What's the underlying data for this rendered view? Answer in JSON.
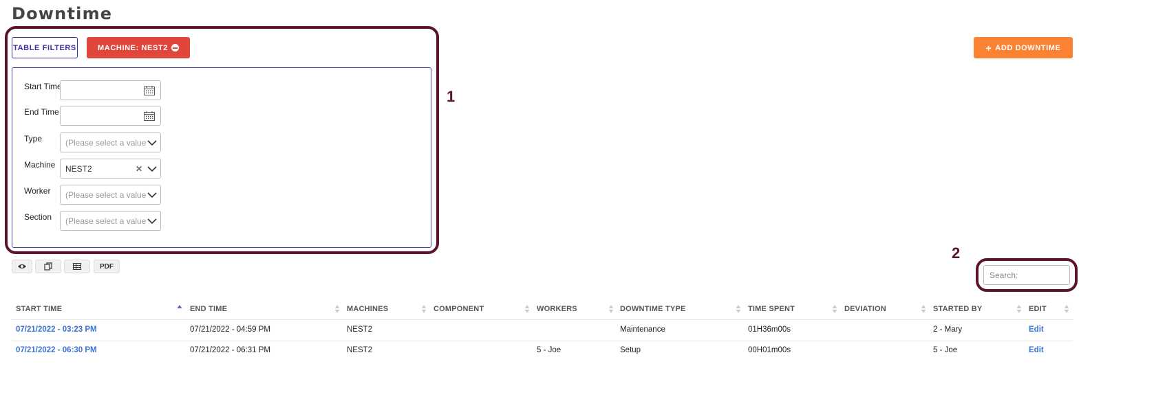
{
  "page": {
    "title": "Downtime"
  },
  "callouts": {
    "first": "1",
    "second": "2"
  },
  "toolbar": {
    "table_filters": "TABLE FILTERS",
    "machine_chip": "MACHINE: NEST2",
    "add_downtime": "ADD DOWNTIME"
  },
  "filters": {
    "start_time": {
      "label": "Start Time",
      "value": ""
    },
    "end_time": {
      "label": "End Time",
      "value": ""
    },
    "type": {
      "label": "Type",
      "placeholder": "(Please select a value)"
    },
    "machine": {
      "label": "Machine",
      "value": "NEST2"
    },
    "worker": {
      "label": "Worker",
      "placeholder": "(Please select a value)"
    },
    "section": {
      "label": "Section",
      "placeholder": "(Please select a value)"
    }
  },
  "table_tools": {
    "pdf": "PDF"
  },
  "search": {
    "placeholder": "Search:"
  },
  "table": {
    "columns": [
      "START TIME",
      "END TIME",
      "MACHINES",
      "COMPONENT",
      "WORKERS",
      "DOWNTIME TYPE",
      "TIME SPENT",
      "DEVIATION",
      "STARTED BY",
      "EDIT"
    ],
    "rows": [
      {
        "start_time": "07/21/2022 - 03:23 PM",
        "end_time": "07/21/2022 - 04:59 PM",
        "machines": "NEST2",
        "component": "",
        "workers": "",
        "downtime_type": "Maintenance",
        "time_spent": "01H36m00s",
        "deviation": "",
        "started_by": "2 - Mary",
        "edit": "Edit"
      },
      {
        "start_time": "07/21/2022 - 06:30 PM",
        "end_time": "07/21/2022 - 06:31 PM",
        "machines": "NEST2",
        "component": "",
        "workers": "5 - Joe",
        "downtime_type": "Setup",
        "time_spent": "00H01m00s",
        "deviation": "",
        "started_by": "5 - Joe",
        "edit": "Edit"
      }
    ]
  },
  "colors": {
    "accent_purple": "#3a30a0",
    "chip_red": "#e0463a",
    "add_orange": "#fb8232",
    "link_blue": "#3b73d4",
    "callout": "#5a1330"
  },
  "icons": {
    "chip": "minus-circle-icon",
    "add": "plus-icon",
    "date": "calendar-icon",
    "select": "chevron-down-icon",
    "clear": "clear-x-icon",
    "tools": [
      "eye-icon",
      "copy-icon",
      "table-icon"
    ],
    "sort": "sort-arrows-icon"
  }
}
